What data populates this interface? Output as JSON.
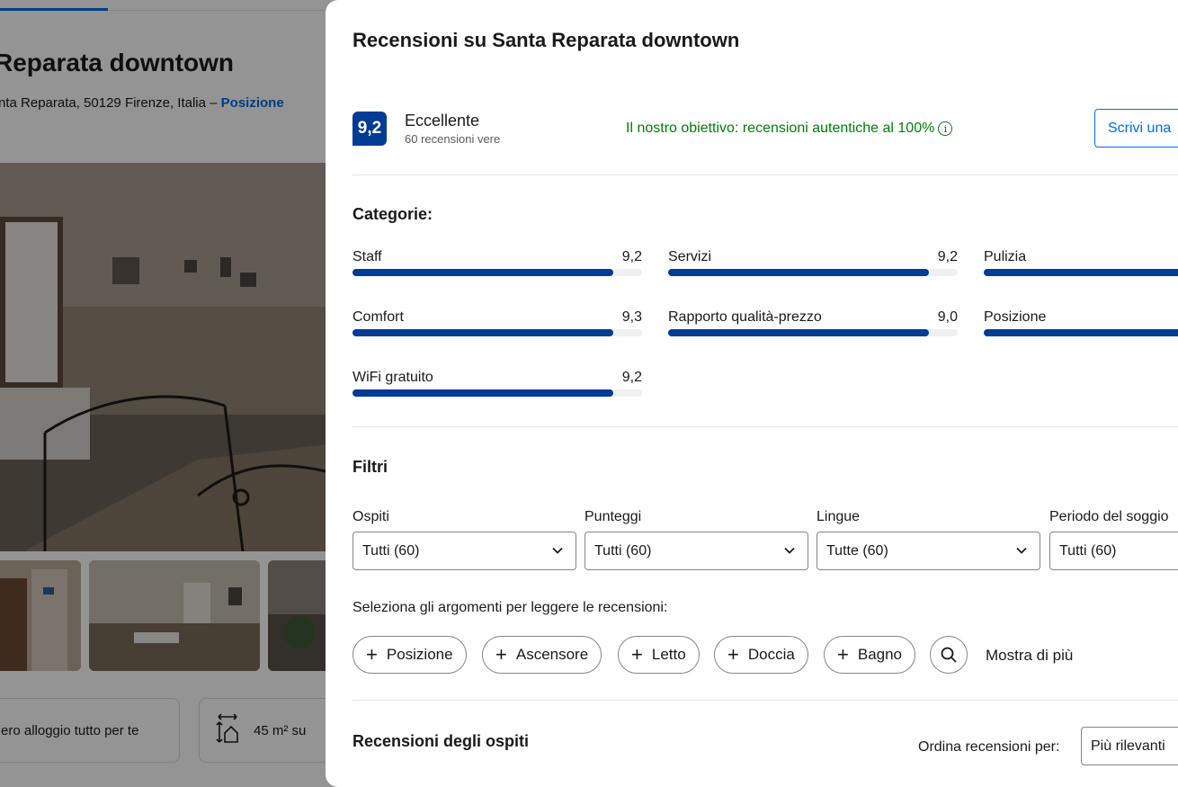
{
  "background": {
    "property_title": "Reparata downtown",
    "address": "nta Reparata, 50129 Firenze, Italia – ",
    "address_link": "Posizione",
    "feature_1": "ero alloggio tutto per te",
    "feature_2": "45 m² su"
  },
  "modal": {
    "title": "Recensioni su Santa Reparata downtown",
    "score": "9,2",
    "score_word": "Eccellente",
    "review_count": "60 recensioni vere",
    "goal_text": "Il nostro obiettivo: recensioni autentiche al 100%",
    "write_review_label": "Scrivi una",
    "categories_heading": "Categorie:",
    "categories": [
      {
        "name": "Staff",
        "value": "9,2",
        "fill": 0.9
      },
      {
        "name": "Servizi",
        "value": "9,2",
        "fill": 0.9
      },
      {
        "name": "Pulizia",
        "value": "",
        "fill": 0.9
      },
      {
        "name": "Comfort",
        "value": "9,3",
        "fill": 0.9
      },
      {
        "name": "Rapporto qualità-prezzo",
        "value": "9,0",
        "fill": 0.9
      },
      {
        "name": "Posizione",
        "value": "",
        "fill": 0.9
      },
      {
        "name": "WiFi gratuito",
        "value": "9,2",
        "fill": 0.9
      }
    ],
    "filters_heading": "Filtri",
    "filters": [
      {
        "label": "Ospiti",
        "value": "Tutti (60)"
      },
      {
        "label": "Punteggi",
        "value": "Tutti (60)"
      },
      {
        "label": "Lingue",
        "value": "Tutte (60)"
      },
      {
        "label": "Periodo del soggio",
        "value": "Tutti (60)"
      }
    ],
    "topics_label": "Seleziona gli argomenti per leggere le recensioni:",
    "topics": [
      "Posizione",
      "Ascensore",
      "Letto",
      "Doccia",
      "Bagno"
    ],
    "show_more": "Mostra di più",
    "guest_reviews_heading": "Recensioni degli ospiti",
    "sort_label": "Ordina recensioni per:",
    "sort_value": "Più rilevanti"
  },
  "colors": {
    "brand_dark_blue": "#003b95",
    "link_blue": "#006ce4",
    "success_green": "#008009"
  }
}
